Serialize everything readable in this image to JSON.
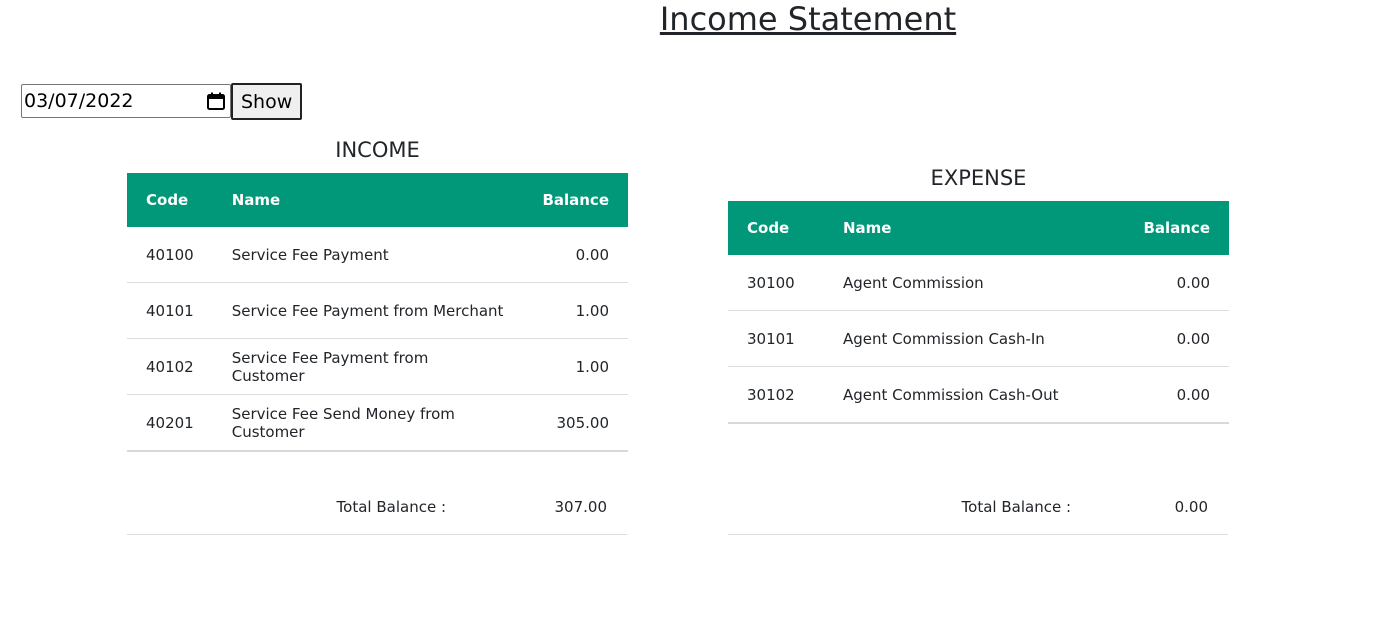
{
  "page": {
    "title": "Income Statement"
  },
  "filter": {
    "date_value": "03/07/2022",
    "show_label": "Show"
  },
  "colors": {
    "header_bg": "#009879",
    "header_text": "#ffffff"
  },
  "income": {
    "title": "INCOME",
    "columns": {
      "code": "Code",
      "name": "Name",
      "balance": "Balance"
    },
    "rows": [
      {
        "code": "40100",
        "name": "Service Fee Payment",
        "balance": "0.00"
      },
      {
        "code": "40101",
        "name": "Service Fee Payment from Merchant",
        "balance": "1.00"
      },
      {
        "code": "40102",
        "name": "Service Fee Payment from Customer",
        "balance": "1.00"
      },
      {
        "code": "40201",
        "name": "Service Fee Send Money from Customer",
        "balance": "305.00"
      }
    ],
    "total_label": "Total Balance :",
    "total_value": "307.00"
  },
  "expense": {
    "title": "EXPENSE",
    "columns": {
      "code": "Code",
      "name": "Name",
      "balance": "Balance"
    },
    "rows": [
      {
        "code": "30100",
        "name": "Agent Commission",
        "balance": "0.00"
      },
      {
        "code": "30101",
        "name": "Agent Commission Cash-In",
        "balance": "0.00"
      },
      {
        "code": "30102",
        "name": "Agent Commission Cash-Out",
        "balance": "0.00"
      }
    ],
    "total_label": "Total Balance :",
    "total_value": "0.00"
  },
  "icons": {
    "date_picker": "calendar-icon"
  }
}
